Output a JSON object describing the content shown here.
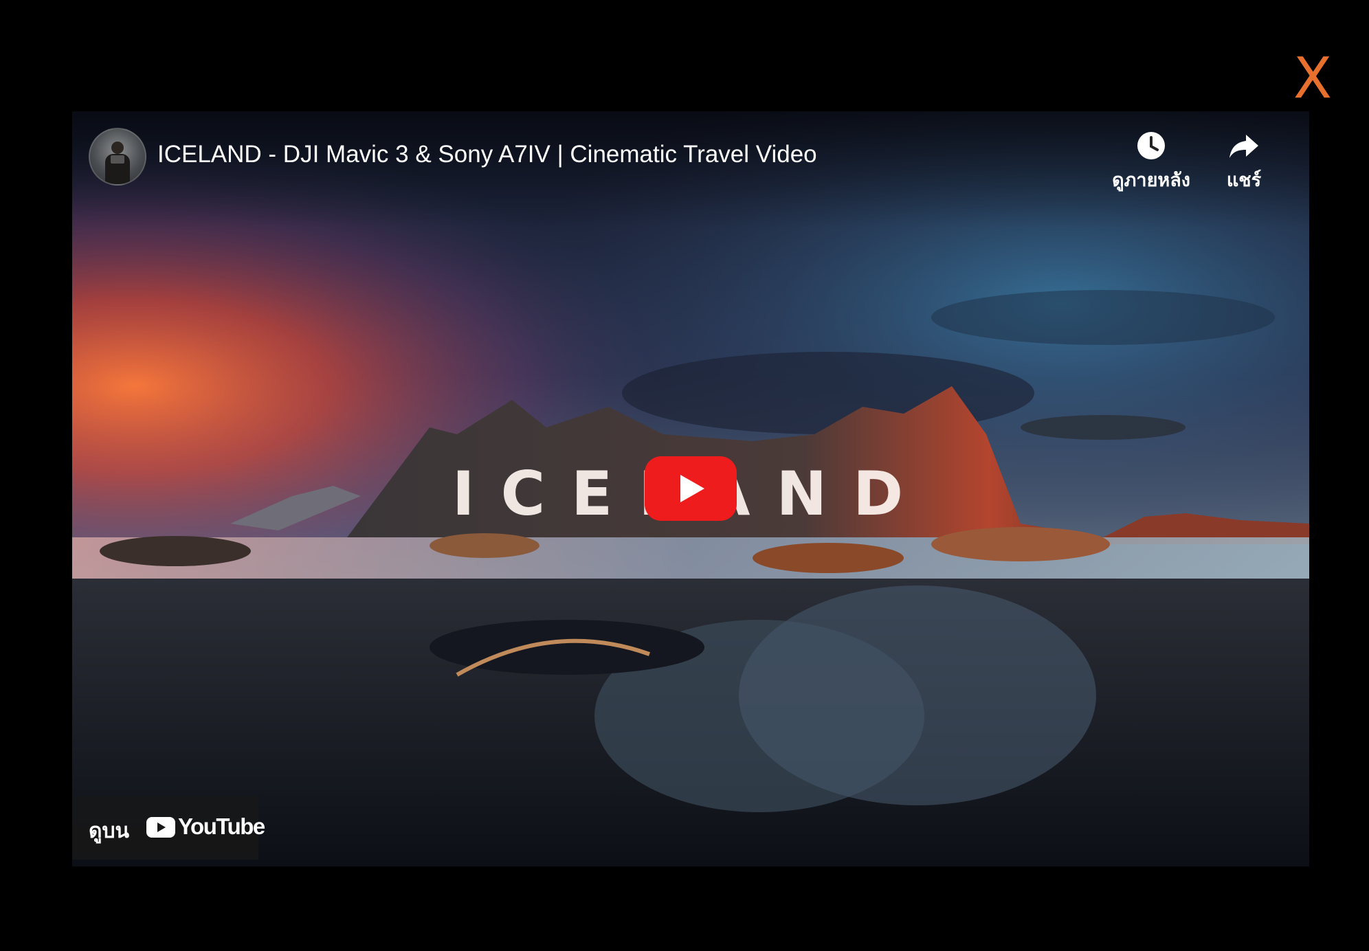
{
  "close": {
    "label": "X",
    "color": "#e8702f"
  },
  "video": {
    "title": "ICELAND - DJI Mavic 3 & Sony A7IV | Cinematic Travel Video",
    "overlay_text": "ICELAND"
  },
  "actions": {
    "watch_later": {
      "label": "ดูภายหลัง",
      "icon": "clock-icon"
    },
    "share": {
      "label": "แชร์",
      "icon": "share-arrow-icon"
    }
  },
  "youtube_link": {
    "prefix": "ดูบน",
    "logo": "YouTube"
  },
  "colors": {
    "play_button": "#ee1c1c",
    "accent": "#e8702f"
  }
}
